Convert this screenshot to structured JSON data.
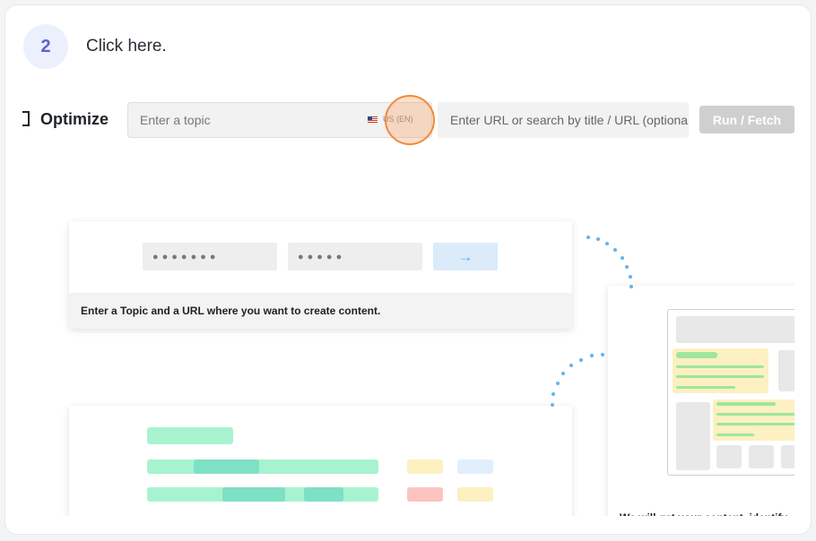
{
  "step": {
    "number": "2",
    "instruction": "Click here."
  },
  "toolbar": {
    "title": "Optimize",
    "topic_placeholder": "Enter a topic",
    "locale_label": "US (EN)",
    "url_placeholder": "Enter URL or search by title / URL (optional)",
    "run_label": "Run / Fetch"
  },
  "illustration": {
    "top_panel": {
      "field_one": "●●●●●●●",
      "field_two": "●●●●●",
      "arrow": "→",
      "caption": "Enter a Topic and a URL where you want to create content."
    },
    "right_panel": {
      "caption": "We will get your content, identify"
    }
  },
  "colors": {
    "accent": "#5b63d3",
    "highlight": "#f28a3a",
    "arrow": "#5aa8ea",
    "green": "#a7f3d0",
    "yellow": "#fdf0c1"
  }
}
